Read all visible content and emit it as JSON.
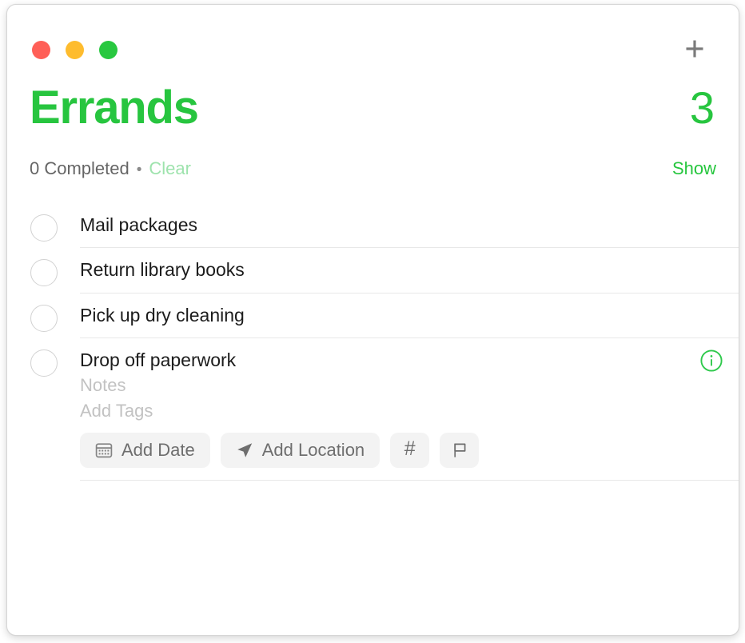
{
  "window": {
    "traffic_lights": [
      {
        "name": "close",
        "color": "#ff5f57"
      },
      {
        "name": "minimize",
        "color": "#febc2e"
      },
      {
        "name": "zoom",
        "color": "#28c840"
      }
    ],
    "add_button_icon": "plus-icon"
  },
  "header": {
    "title": "Errands",
    "count": "3",
    "completed_text": "0 Completed",
    "separator": "•",
    "clear_label": "Clear",
    "show_label": "Show",
    "accent_color": "#27c53f",
    "clear_disabled_color": "#9ee3ad"
  },
  "tasks": [
    {
      "title": "Mail packages",
      "completed": false,
      "expanded": false
    },
    {
      "title": "Return library books",
      "completed": false,
      "expanded": false
    },
    {
      "title": "Pick up dry cleaning",
      "completed": false,
      "expanded": false
    },
    {
      "title": "Drop off paperwork",
      "completed": false,
      "expanded": true,
      "notes_placeholder": "Notes",
      "tags_placeholder": "Add Tags",
      "info_icon": "info-circle-icon",
      "actions": [
        {
          "label": "Add Date",
          "icon": "calendar-icon"
        },
        {
          "label": "Add Location",
          "icon": "location-arrow-icon"
        },
        {
          "label": "#",
          "icon": "hash-icon"
        },
        {
          "label": "",
          "icon": "flag-icon"
        }
      ]
    }
  ]
}
